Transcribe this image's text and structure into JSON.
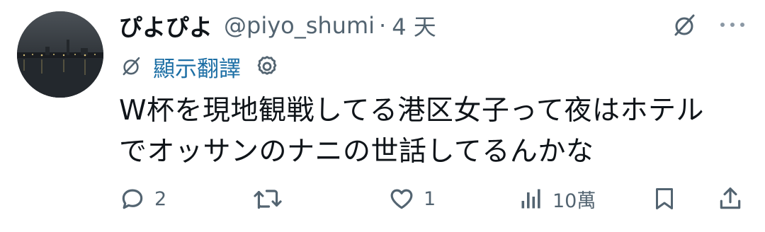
{
  "tweet": {
    "display_name": "ぴよぴよ",
    "handle": "@piyo_shumi",
    "separator": "·",
    "time": "4 天",
    "translate_label": "顯示翻譯",
    "body_lines": [
      "W杯を現地観戦してる港区女子って夜はホテル",
      "でオッサンのナニの世話してるんかな"
    ]
  },
  "actions": {
    "replies": "2",
    "retweets": "",
    "likes": "1",
    "views": "10萬"
  },
  "icons": {
    "avatar": "night-harbor-photo",
    "grok": "grok-icon",
    "more": "more-icon",
    "translate": "grok-icon",
    "settings": "gear-icon",
    "reply": "reply-icon",
    "retweet": "retweet-icon",
    "like": "heart-icon",
    "views": "views-icon",
    "bookmark": "bookmark-icon",
    "share": "share-icon"
  },
  "colors": {
    "text": "#0f1419",
    "secondary": "#536471",
    "link": "#1d6fa5"
  }
}
